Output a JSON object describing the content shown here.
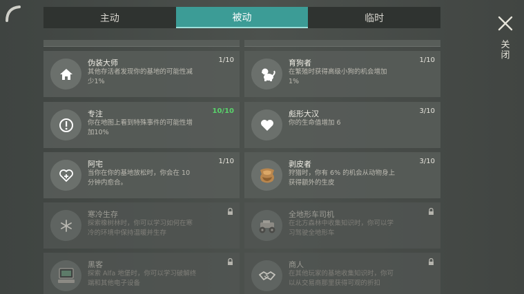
{
  "tabs": [
    {
      "label": "主动"
    },
    {
      "label": "被动"
    },
    {
      "label": "临时"
    }
  ],
  "close_label": "关闭",
  "perks": [
    {
      "name": "伪装大师",
      "desc": "其他存活者发现你的基地的可能性减少1%",
      "level": "1/10",
      "icon": "home-icon",
      "locked": false
    },
    {
      "name": "育狗者",
      "desc": "在繁殖时获得高级小狗的机会增加 1%",
      "level": "1/10",
      "icon": "dog-icon",
      "locked": false
    },
    {
      "name": "专注",
      "desc": "你在地图上看到特殊事件的可能性增加10%",
      "level": "10/10",
      "icon": "alert-icon",
      "locked": false
    },
    {
      "name": "彪形大汉",
      "desc": "你的生命值增加 6",
      "level": "3/10",
      "icon": "heart-icon",
      "locked": false
    },
    {
      "name": "阿宅",
      "desc": "当你在你的基地放松时，你会在 10 分钟内愈合。",
      "level": "1/10",
      "icon": "heart-plus-icon",
      "locked": false
    },
    {
      "name": "剥皮者",
      "desc": "狩猎时，你有 6% 的机会从动物身上获得额外的生皮",
      "level": "3/10",
      "icon": "hide-icon",
      "locked": false
    },
    {
      "name": "寒冷生存",
      "desc": "探索橡树林时，你可以学习如何在寒冷的环境中保持温暖并生存",
      "level": "",
      "icon": "snowflake-icon",
      "locked": true
    },
    {
      "name": "全地形车司机",
      "desc": "在北方森林中收集知识时，你可以学习驾驶全地形车",
      "level": "",
      "icon": "atv-icon",
      "locked": true
    },
    {
      "name": "黑客",
      "desc": "探索 Alfa 地堡时，你可以学习破解终端和其他电子设备",
      "level": "",
      "icon": "computer-icon",
      "locked": true
    },
    {
      "name": "商人",
      "desc": "在其他玩家的基地收集知识时，你可以从交易商那里获得可观的折扣",
      "level": "",
      "icon": "handshake-icon",
      "locked": true
    }
  ],
  "colors": {
    "accent": "#3c9c96",
    "max_level": "#59d36b"
  }
}
